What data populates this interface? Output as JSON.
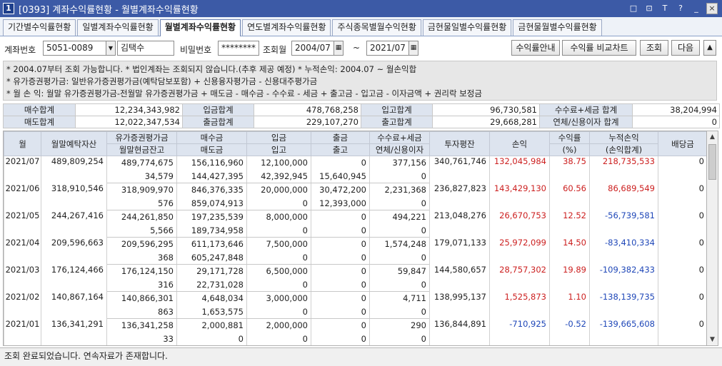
{
  "window": {
    "number": "1",
    "title": "[0393] 계좌수익률현황 - 월별계좌수익률현황",
    "controls": [
      "□",
      "⊡",
      "T",
      "?",
      "_",
      "×"
    ]
  },
  "tabs": [
    "기간별수익률현황",
    "일별계좌수익률현황",
    "월별계좌수익률현황",
    "연도별계좌수익률현황",
    "주식종목별월수익현황",
    "금현물일별수익률현황",
    "금현물월별수익률현황"
  ],
  "active_tab": 2,
  "filter": {
    "account_label": "계좌번호",
    "account_value": "5051-0089",
    "owner_name": "김택수",
    "password_label": "비밀번호",
    "password_value": "********",
    "month_label": "조회월",
    "from_month": "2004/07",
    "range_sep": "~",
    "to_month": "2021/07",
    "buttons": {
      "guide": "수익률안내",
      "compare": "수익률 비교차트",
      "search": "조회",
      "next": "다음",
      "up": "▲"
    }
  },
  "info_lines": [
    "* 2004.07부터 조회 가능합니다.    * 법인계좌는 조회되지 않습니다.(추후 제공 예정)    * 누적손익: 2004.07 ~ 월손익합",
    "* 유가증권평가금: 일반유가증권평가금(예탁담보포함) + 신용융자평가금 - 신용대주평가금",
    "* 월 손 익: 월말 유가증권평가금-전월말 유가증권평가금 + 매도금 - 매수금 - 수수료 - 세금 + 출고금 - 입고금 - 이자금액 + 권리락 보정금"
  ],
  "summary": {
    "row1": [
      {
        "label": "매수합계",
        "value": "12,234,343,982"
      },
      {
        "label": "입금합계",
        "value": "478,768,258"
      },
      {
        "label": "입고합계",
        "value": "96,730,581"
      },
      {
        "label": "수수료+세금 합계",
        "value": "38,204,994"
      }
    ],
    "row2": [
      {
        "label": "매도합계",
        "value": "12,022,347,534"
      },
      {
        "label": "출금합계",
        "value": "229,107,270"
      },
      {
        "label": "출고합계",
        "value": "29,668,281"
      },
      {
        "label": "연체/신용이자 합계",
        "value": "0"
      }
    ]
  },
  "grid": {
    "headers_top": [
      "월",
      "월말예탁자산",
      "유가증권평가금",
      "매수금",
      "입금",
      "출금",
      "수수료+세금",
      "투자평잔",
      "손익",
      "수익률",
      "누적손익",
      "배당금"
    ],
    "headers_bottom": [
      "월말현금잔고",
      "매도금",
      "입고",
      "출고",
      "연체/신용이자",
      "(%)",
      "(손익합계)"
    ],
    "rows": [
      {
        "month": "2021/07",
        "deposit": "489,809,254",
        "securities": "489,774,675",
        "cash": "34,579",
        "buy": "156,116,960",
        "sell": "144,427,395",
        "in_money": "12,100,000",
        "in_goods": "42,392,945",
        "out_money": "0",
        "out_goods": "15,640,945",
        "fee": "377,156",
        "interest": "0",
        "avg_invest": "340,761,746",
        "pnl": "132,045,984",
        "rate": "38.75",
        "cum": "218,735,533",
        "div": "0",
        "pnl_sign": "pos",
        "cum_sign": "pos"
      },
      {
        "month": "2021/06",
        "deposit": "318,910,546",
        "securities": "318,909,970",
        "cash": "576",
        "buy": "846,376,335",
        "sell": "859,074,913",
        "in_money": "20,000,000",
        "in_goods": "0",
        "out_money": "30,472,200",
        "out_goods": "12,393,000",
        "fee": "2,231,368",
        "interest": "0",
        "avg_invest": "236,827,823",
        "pnl": "143,429,130",
        "rate": "60.56",
        "cum": "86,689,549",
        "div": "0",
        "pnl_sign": "pos",
        "cum_sign": "pos"
      },
      {
        "month": "2021/05",
        "deposit": "244,267,416",
        "securities": "244,261,850",
        "cash": "5,566",
        "buy": "197,235,539",
        "sell": "189,734,958",
        "in_money": "8,000,000",
        "in_goods": "0",
        "out_money": "0",
        "out_goods": "0",
        "fee": "494,221",
        "interest": "0",
        "avg_invest": "213,048,276",
        "pnl": "26,670,753",
        "rate": "12.52",
        "cum": "-56,739,581",
        "div": "0",
        "pnl_sign": "pos",
        "cum_sign": "neg"
      },
      {
        "month": "2021/04",
        "deposit": "209,596,663",
        "securities": "209,596,295",
        "cash": "368",
        "buy": "611,173,646",
        "sell": "605,247,848",
        "in_money": "7,500,000",
        "in_goods": "0",
        "out_money": "0",
        "out_goods": "0",
        "fee": "1,574,248",
        "interest": "0",
        "avg_invest": "179,071,133",
        "pnl": "25,972,099",
        "rate": "14.50",
        "cum": "-83,410,334",
        "div": "0",
        "pnl_sign": "pos",
        "cum_sign": "neg"
      },
      {
        "month": "2021/03",
        "deposit": "176,124,466",
        "securities": "176,124,150",
        "cash": "316",
        "buy": "29,171,728",
        "sell": "22,731,028",
        "in_money": "6,500,000",
        "in_goods": "0",
        "out_money": "0",
        "out_goods": "0",
        "fee": "59,847",
        "interest": "0",
        "avg_invest": "144,580,657",
        "pnl": "28,757,302",
        "rate": "19.89",
        "cum": "-109,382,433",
        "div": "0",
        "pnl_sign": "pos",
        "cum_sign": "neg"
      },
      {
        "month": "2021/02",
        "deposit": "140,867,164",
        "securities": "140,866,301",
        "cash": "863",
        "buy": "4,648,034",
        "sell": "1,653,575",
        "in_money": "3,000,000",
        "in_goods": "0",
        "out_money": "0",
        "out_goods": "0",
        "fee": "4,711",
        "interest": "0",
        "avg_invest": "138,995,137",
        "pnl": "1,525,873",
        "rate": "1.10",
        "cum": "-138,139,735",
        "div": "0",
        "pnl_sign": "pos",
        "cum_sign": "neg"
      },
      {
        "month": "2021/01",
        "deposit": "136,341,291",
        "securities": "136,341,258",
        "cash": "33",
        "buy": "2,000,881",
        "sell": "0",
        "in_money": "2,000,000",
        "in_goods": "0",
        "out_money": "0",
        "out_goods": "0",
        "fee": "290",
        "interest": "0",
        "avg_invest": "136,844,891",
        "pnl": "-710,925",
        "rate": "-0.52",
        "cum": "-139,665,608",
        "div": "0",
        "pnl_sign": "neg",
        "cum_sign": "neg"
      }
    ]
  },
  "status": "조회 완료되었습니다. 연속자료가 존재합니다.",
  "colors": {
    "positive": "#cc1f1f",
    "negative": "#1f47b8",
    "titlebar": "#3c5aa6",
    "header_bg": "#dde4ef"
  }
}
